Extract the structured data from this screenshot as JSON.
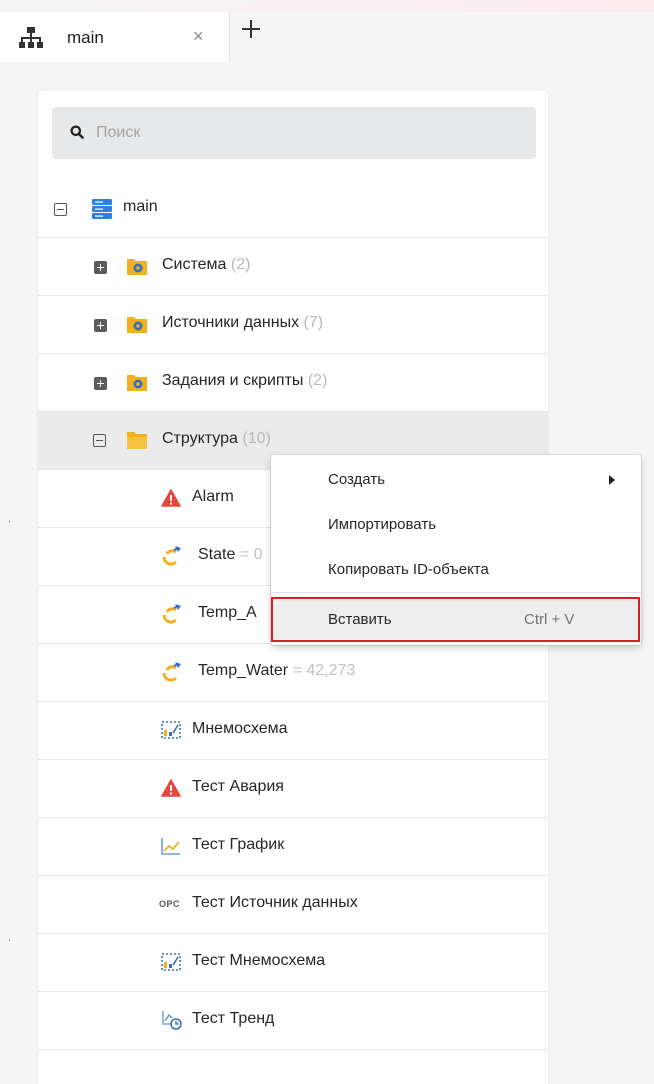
{
  "tabs": {
    "active_label": "main",
    "close_glyph": "×",
    "icons": {
      "tab": "hierarchy-icon",
      "add": "plus-icon",
      "close": "close-icon"
    }
  },
  "search": {
    "placeholder": "Поиск",
    "value": "",
    "icon": "search-icon"
  },
  "tree": {
    "root": {
      "label": "main",
      "icon": "server-icon",
      "expanded": true
    },
    "folders": [
      {
        "label": "Система",
        "count": "(2)",
        "expanded": false,
        "icon": "gear-folder-icon"
      },
      {
        "label": "Источники данных",
        "count": "(7)",
        "expanded": false,
        "icon": "gear-folder-icon"
      },
      {
        "label": "Задания и скрипты",
        "count": "(2)",
        "expanded": false,
        "icon": "gear-folder-icon"
      },
      {
        "label": "Структура",
        "count": "(10)",
        "expanded": true,
        "selected": true,
        "icon": "folder-icon"
      }
    ],
    "children": [
      {
        "label": "Alarm",
        "value": "",
        "icon": "alarm-icon"
      },
      {
        "label": "State",
        "value": "= 0",
        "icon": "variable-icon"
      },
      {
        "label": "Temp_A",
        "value": "",
        "icon": "variable-icon"
      },
      {
        "label": "Temp_Water",
        "value": "= 42,273",
        "icon": "variable-icon"
      },
      {
        "label": "Мнемосхема",
        "value": "",
        "icon": "mnemonic-icon"
      },
      {
        "label": "Тест Авария",
        "value": "",
        "icon": "alarm-icon"
      },
      {
        "label": "Тест График",
        "value": "",
        "icon": "chart-icon"
      },
      {
        "label": "Тест Источник данных",
        "value": "",
        "icon": "opc-icon",
        "icon_text": "OPC"
      },
      {
        "label": "Тест Мнемосхема",
        "value": "",
        "icon": "mnemonic-icon"
      },
      {
        "label": "Тест Тренд",
        "value": "",
        "icon": "trend-icon"
      }
    ]
  },
  "context_menu": {
    "items": [
      {
        "label": "Создать",
        "has_submenu": true,
        "shortcut": ""
      },
      {
        "label": "Импортировать",
        "shortcut": ""
      },
      {
        "label": "Копировать ID-объекта",
        "shortcut": ""
      },
      {
        "label": "Вставить",
        "shortcut": "Ctrl + V",
        "highlighted": true
      }
    ]
  },
  "colors": {
    "background": "#f5f5f5",
    "panel": "#ffffff",
    "selected_row": "#ebebeb",
    "folder": "#f2b01e",
    "alarm": "#e4483c",
    "server": "#2f7fe0",
    "highlight_outline": "#d62028",
    "muted_text": "#b8b8b8"
  }
}
